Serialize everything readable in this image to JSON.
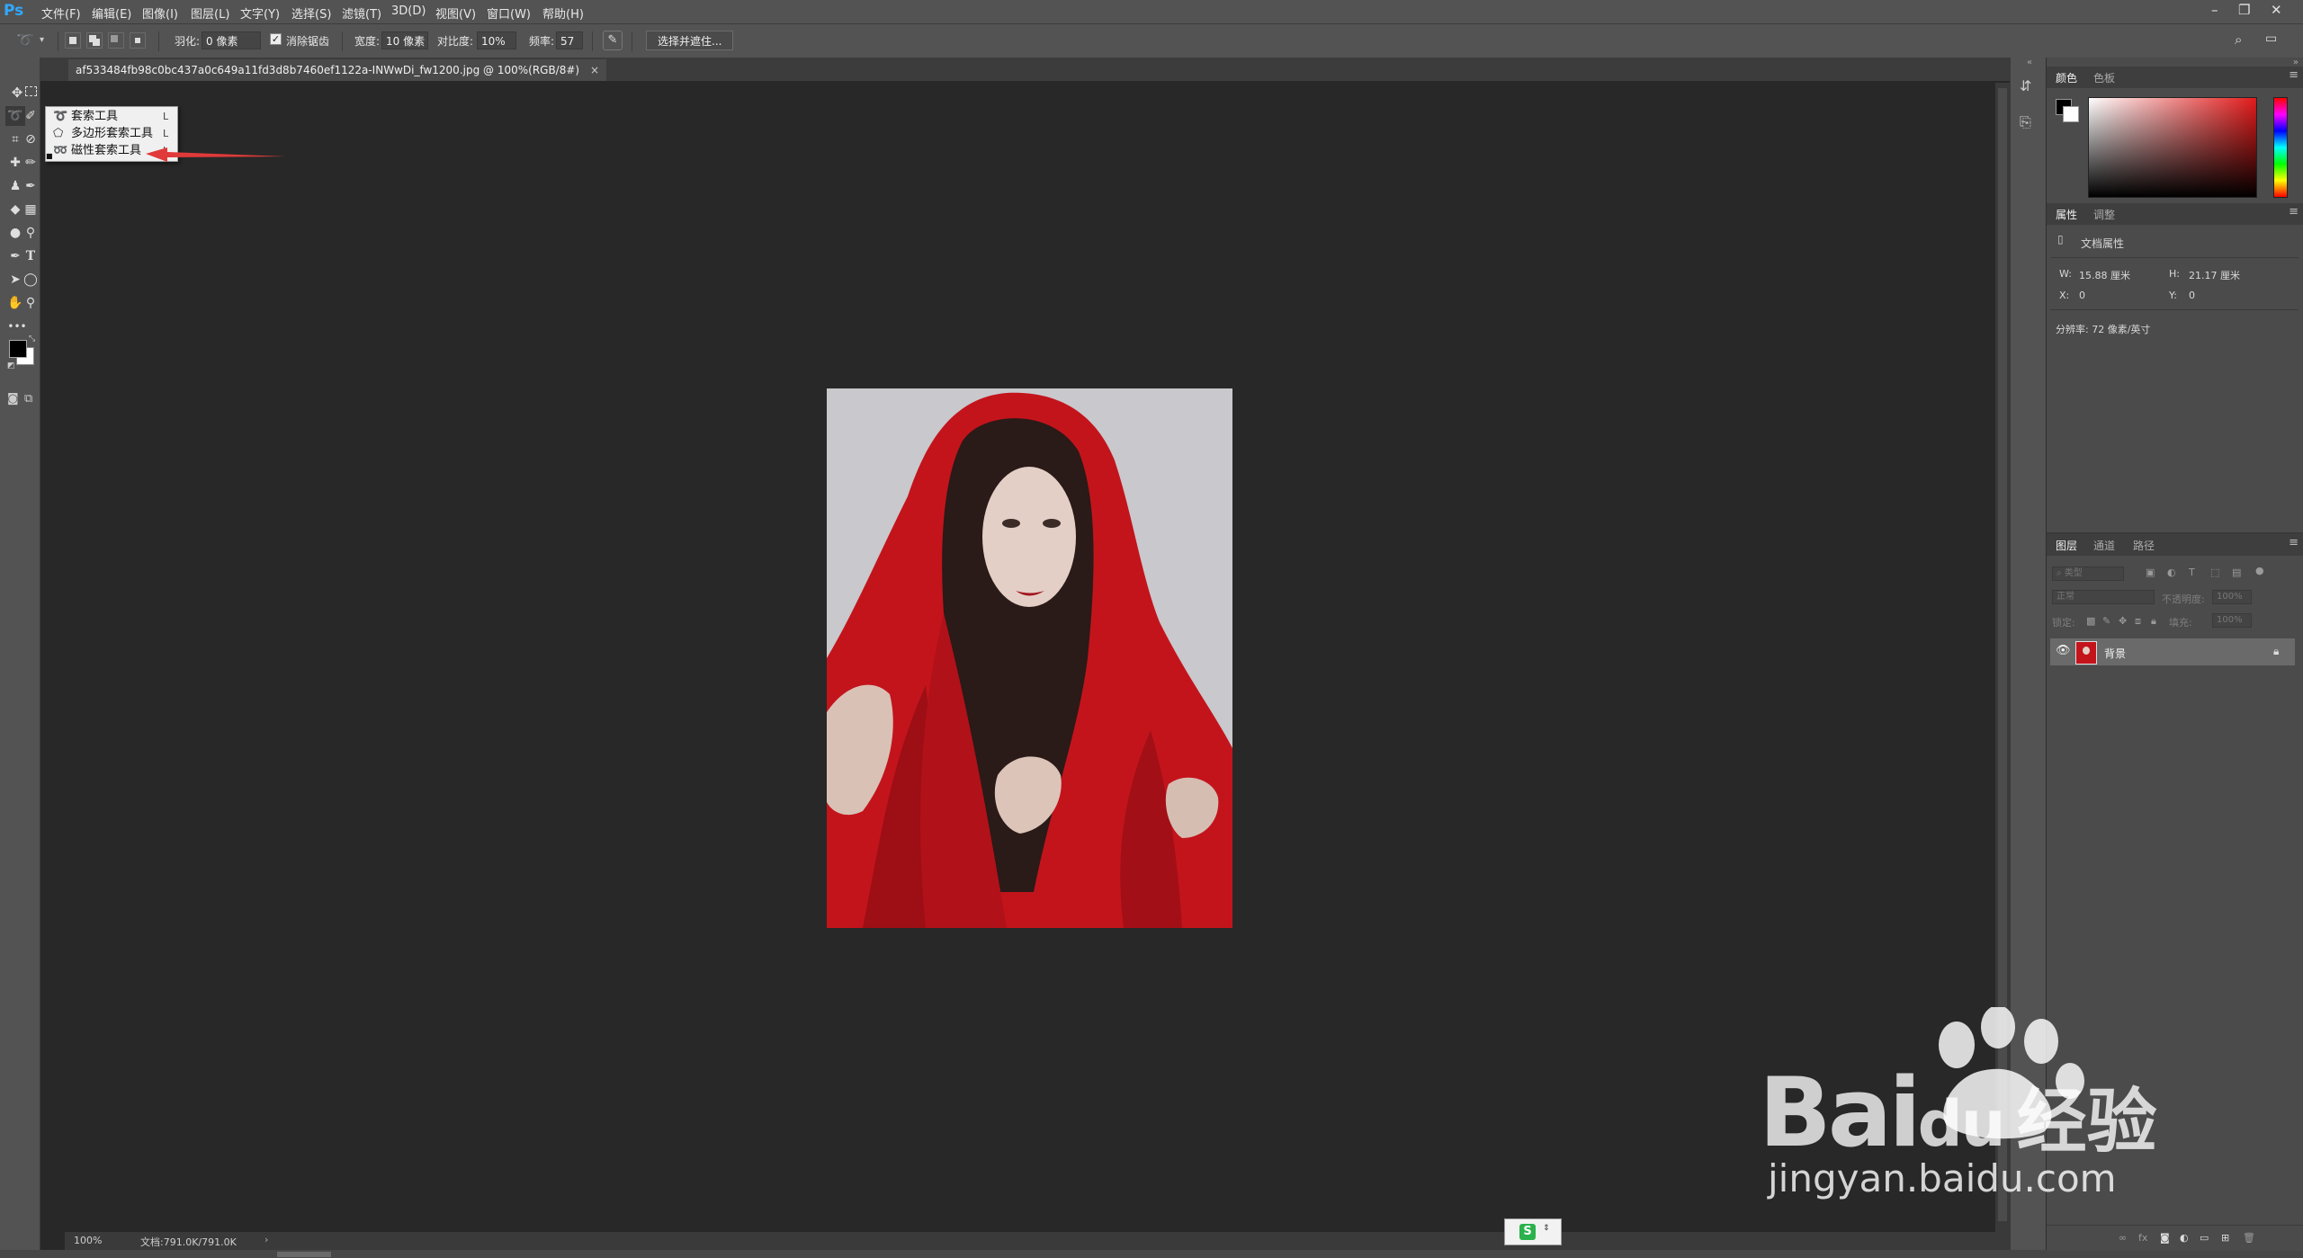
{
  "app": {
    "logo": "Ps"
  },
  "menu": [
    "文件(F)",
    "编辑(E)",
    "图像(I)",
    "图层(L)",
    "文字(Y)",
    "选择(S)",
    "滤镜(T)",
    "3D(D)",
    "视图(V)",
    "窗口(W)",
    "帮助(H)"
  ],
  "window_controls": {
    "minimize": "–",
    "restore": "❐",
    "close": "✕"
  },
  "options": {
    "feather_label": "羽化:",
    "feather_value": "0 像素",
    "antialias_label": "消除锯齿",
    "width_label": "宽度:",
    "width_value": "10 像素",
    "contrast_label": "对比度:",
    "contrast_value": "10%",
    "frequency_label": "频率:",
    "frequency_value": "57",
    "select_mask_button": "选择并遮住..."
  },
  "document": {
    "tab_title": "af533484fb98c0bc437a0c649a11fd3d8b7460ef1122a-INWwDi_fw1200.jpg @ 100%(RGB/8#)",
    "tab_close": "×",
    "zoom": "100%",
    "doc_info": "文档:791.0K/791.0K"
  },
  "flyout": {
    "items": [
      {
        "icon": "lasso-icon",
        "label": "套索工具",
        "key": "L"
      },
      {
        "icon": "polygonal-lasso-icon",
        "label": "多边形套索工具",
        "key": "L"
      },
      {
        "icon": "magnetic-lasso-icon",
        "label": "磁性套索工具",
        "key": "L"
      }
    ],
    "selected_index": 2
  },
  "annotation": {
    "arrow_color": "#e03a3a"
  },
  "color_panel": {
    "tabs": [
      "颜色",
      "色板"
    ],
    "hue_color": "#e31b1b"
  },
  "properties_panel": {
    "tabs": [
      "属性",
      "调整"
    ],
    "title": "文档属性",
    "w_label": "W:",
    "w_value": "15.88 厘米",
    "h_label": "H:",
    "h_value": "21.17 厘米",
    "x_label": "X:",
    "x_value": "0",
    "y_label": "Y:",
    "y_value": "0",
    "resolution": "分辨率: 72 像素/英寸"
  },
  "layers_panel": {
    "tabs": [
      "图层",
      "通道",
      "路径"
    ],
    "filter_placeholder": "类型",
    "blend_mode": "正常",
    "opacity_label": "不透明度:",
    "opacity_value": "100%",
    "lock_label": "锁定:",
    "fill_label": "填充:",
    "fill_value": "100%",
    "layers": [
      {
        "name": "背景",
        "visible": true,
        "locked": true
      }
    ]
  },
  "watermark": {
    "brand": "Bai",
    "brand2": "du",
    "brand_cn": "经验",
    "url": "jingyan.baidu.com"
  }
}
